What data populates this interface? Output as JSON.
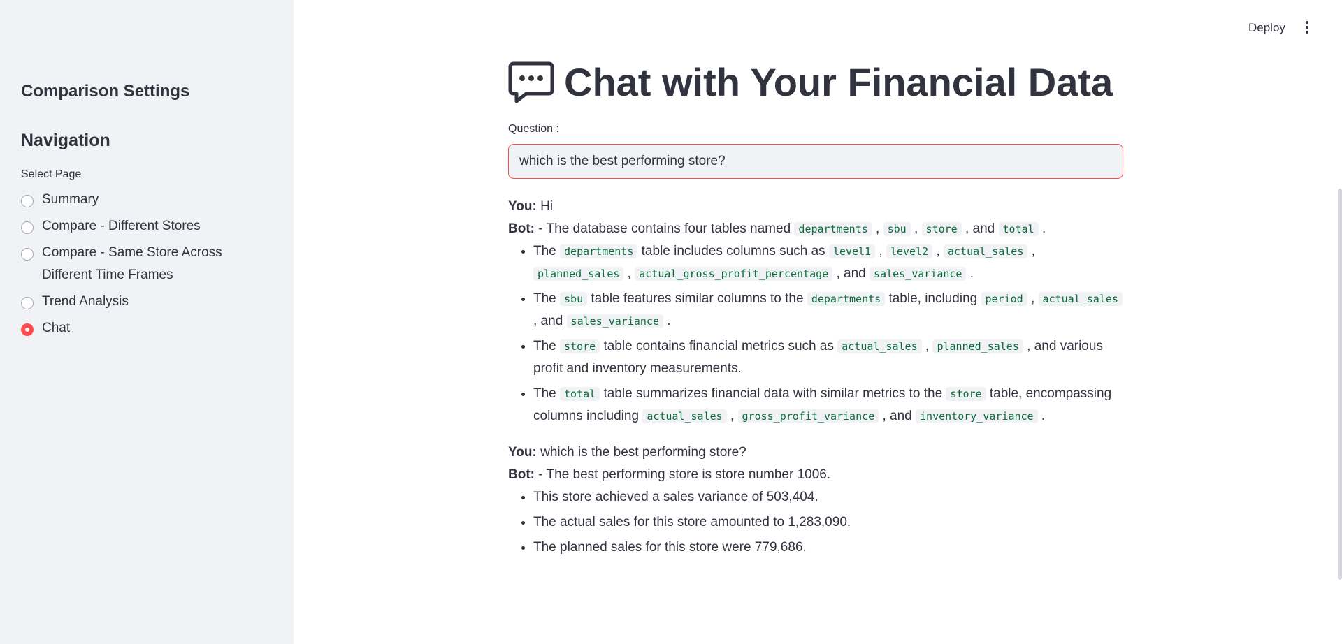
{
  "sidebar": {
    "settings_title": "Comparison Settings",
    "nav_title": "Navigation",
    "select_label": "Select Page",
    "pages": [
      {
        "label": "Summary",
        "selected": false
      },
      {
        "label": "Compare - Different Stores",
        "selected": false
      },
      {
        "label": "Compare - Same Store Across Different Time Frames",
        "selected": false
      },
      {
        "label": "Trend Analysis",
        "selected": false
      },
      {
        "label": "Chat",
        "selected": true
      }
    ]
  },
  "header": {
    "deploy_label": "Deploy",
    "menu_icon": "kebab-menu-icon"
  },
  "main": {
    "title_icon": "speech-bubble-icon",
    "title": "Chat with Your Financial Data",
    "question_label": "Question :",
    "question_value": "which is the best performing store?"
  },
  "chat": {
    "m1_speaker": "You:",
    "m1_text": " Hi",
    "m2_speaker": "Bot:",
    "m2_text_a": " - The database contains four tables named ",
    "m2_code_1": "departments",
    "m2_sep_1": " , ",
    "m2_code_2": "sbu",
    "m2_sep_2": " , ",
    "m2_code_3": "store",
    "m2_sep_3": " , and ",
    "m2_code_4": "total",
    "m2_end": " .",
    "b1": {
      "t1": "The ",
      "c1": "departments",
      "t2": " table includes columns such as ",
      "c2": "level1",
      "s1": " , ",
      "c3": "level2",
      "s2": " , ",
      "c4": "actual_sales",
      "s3": " , ",
      "c5": "planned_sales",
      "s4": " , ",
      "c6": "actual_gross_profit_percentage",
      "s5": " , and ",
      "c7": "sales_variance",
      "end": " ."
    },
    "b2": {
      "t1": "The ",
      "c1": "sbu",
      "t2": " table features similar columns to the ",
      "c2": "departments",
      "t3": " table, including ",
      "c3": "period",
      "s1": " , ",
      "c4": "actual_sales",
      "s2": " , and ",
      "c5": "sales_variance",
      "end": " ."
    },
    "b3": {
      "t1": "The ",
      "c1": "store",
      "t2": " table contains financial metrics such as ",
      "c2": "actual_sales",
      "s1": " , ",
      "c3": "planned_sales",
      "t3": " , and various profit and inventory measurements."
    },
    "b4": {
      "t1": "The ",
      "c1": "total",
      "t2": " table summarizes financial data with similar metrics to the ",
      "c2": "store",
      "t3": " table, encompassing columns including ",
      "c3": "actual_sales",
      "s1": " , ",
      "c4": "gross_profit_variance",
      "s2": " , and ",
      "c5": "inventory_variance",
      "end": " ."
    },
    "m3_speaker": "You:",
    "m3_text": " which is the best performing store?",
    "m4_speaker": "Bot:",
    "m4_text": " - The best performing store is store number 1006.",
    "m4_bullets": [
      "This store achieved a sales variance of 503,404.",
      "The actual sales for this store amounted to 1,283,090.",
      "The planned sales for this store were 779,686."
    ]
  }
}
